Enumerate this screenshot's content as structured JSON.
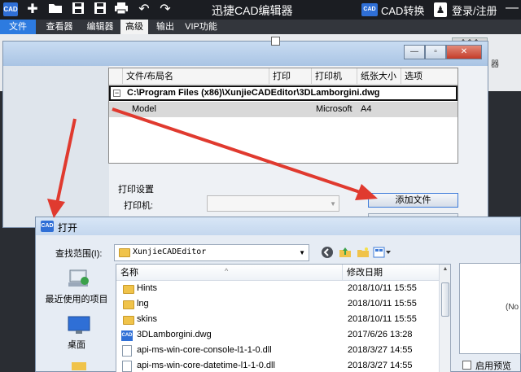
{
  "app": {
    "logo_text": "CAD",
    "title": "迅捷CAD编辑器",
    "convert_logo": "CAD",
    "convert_label": "CAD转换",
    "login_label": "登录/注册",
    "minimize_glyph": "—"
  },
  "menu": {
    "file": "文件",
    "items": [
      "查看器",
      "编辑器",
      "高级",
      "输出",
      "VIP功能"
    ],
    "active": "高级"
  },
  "ribbon": {
    "right_button": "全命令",
    "right_text": "器"
  },
  "print_dialog": {
    "columns": [
      "文件/布局名",
      "打印",
      "打印机",
      "纸张大小",
      "选项"
    ],
    "group_toggle": "−",
    "group_path": "C:\\Program Files (x86)\\XunjieCADEditor\\3DLamborgini.dwg",
    "row": {
      "name": "Model",
      "printer": "Microsoft",
      "paper": "A4"
    },
    "settings_title": "打印设置",
    "printer_label": "打印机:",
    "add_file_button": "添加文件"
  },
  "open_dialog": {
    "logo_text": "CAD",
    "title": "打开",
    "lookin_label": "查找范围(I):",
    "lookin_value": "XunjieCADEditor",
    "places": [
      "最近使用的项目",
      "桌面"
    ],
    "columns": {
      "name": "名称",
      "date": "修改日期"
    },
    "files": [
      {
        "name": "Hints",
        "date": "2018/10/11 15:55",
        "kind": "folder"
      },
      {
        "name": "lng",
        "date": "2018/10/11 15:55",
        "kind": "folder"
      },
      {
        "name": "skins",
        "date": "2018/10/11 15:55",
        "kind": "folder"
      },
      {
        "name": "3DLamborgini.dwg",
        "date": "2017/6/26 13:28",
        "kind": "dwg"
      },
      {
        "name": "api-ms-win-core-console-l1-1-0.dll",
        "date": "2018/3/27 14:55",
        "kind": "dll"
      },
      {
        "name": "api-ms-win-core-datetime-l1-1-0.dll",
        "date": "2018/3/27 14:55",
        "kind": "dll"
      }
    ],
    "preview_text": "(No",
    "preview_checkbox_label": "启用预览"
  }
}
